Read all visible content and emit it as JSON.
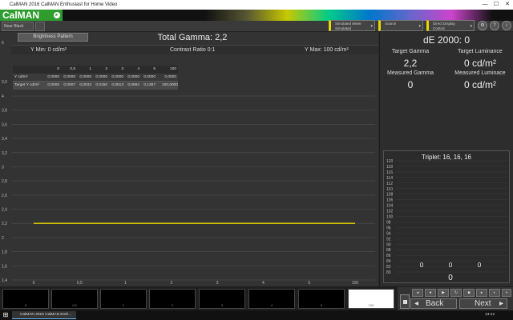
{
  "window": {
    "title": "CalMAN 2016 CalMAN Enthusiast for Home Video",
    "minimize": "—",
    "maximize": "☐",
    "close": "✕"
  },
  "app": {
    "logo": "CalMAN",
    "logo_icon": "play-arrow-icon"
  },
  "toolbar": {
    "near_black": "Near Black",
    "meter_select": {
      "line1": "Simulated Meter",
      "line2": "Simulated"
    },
    "source_select": {
      "line1": "Source"
    },
    "display_select": {
      "line1": "Direct Display Control"
    },
    "icons": [
      "settings-icon",
      "help-icon",
      "info-icon"
    ]
  },
  "main": {
    "pattern_button": "Brightness Pattern",
    "total_gamma_label": "Total Gamma: 2,2",
    "y_min": "Y Min: 0 cd/m²",
    "contrast": "Contrast Ratio 0:1",
    "y_max": "Y Max: 100 cd/m²",
    "table": {
      "headers": [
        "0",
        "0,5",
        "1",
        "2",
        "3",
        "4",
        "5",
        "100"
      ],
      "rows": [
        {
          "label": "Y cd/m²",
          "values": [
            "0,0000",
            "0,0000",
            "0,0000",
            "0,0000",
            "0,0000",
            "0,0000",
            "0,0000",
            "0,0000"
          ]
        },
        {
          "label": "Target Y cd/m²",
          "values": [
            "0,0000",
            "0,0007",
            "0,0033",
            "0,0150",
            "0,0513",
            "0,0892",
            "0,1387",
            "100,0000"
          ]
        }
      ]
    }
  },
  "chart_data": {
    "type": "line",
    "categories": [
      "0",
      "0,5",
      "1",
      "2",
      "3",
      "4",
      "5",
      "100"
    ],
    "y_ticks": [
      "1,4",
      "1,6",
      "1,8",
      "2",
      "2,2",
      "2,4",
      "2,6",
      "2,8",
      "3",
      "3,2",
      "3,4",
      "3,6",
      "3,8",
      "4"
    ],
    "top_ticks": [
      "3,0",
      "6"
    ],
    "ylim": [
      1.4,
      4.0
    ],
    "series": [
      {
        "values": [
          2.2,
          2.2,
          2.2,
          2.2,
          2.2,
          2.2,
          2.2,
          2.2
        ],
        "color": "#e6d800"
      }
    ],
    "grid": true
  },
  "right": {
    "de2000": "dE 2000: 0",
    "target_gamma_label": "Target  Gamma",
    "target_gamma_value": "2,2",
    "target_luminance_label": "Target Luminance",
    "target_luminance_value": "0 cd/m²",
    "measured_gamma_label": "Measured Gamma",
    "measured_gamma_value": "0",
    "measured_luminance_label": "Measured Luminace",
    "measured_luminance_value": "0 cd/m²",
    "triplet_label": "Triplet: 16, 16, 16",
    "triplet_values": [
      "0",
      "0",
      "0"
    ],
    "triplet_total": "0",
    "triplet_axis": [
      "120",
      "118",
      "116",
      "114",
      "112",
      "110",
      "108",
      "106",
      "104",
      "102",
      "100",
      "98",
      "96",
      "94",
      "92",
      "90",
      "88",
      "86",
      "84",
      "82",
      "80"
    ]
  },
  "bottom": {
    "swatches": [
      "0",
      "0,5",
      "1",
      "2",
      "3",
      "4",
      "5",
      "100"
    ],
    "back": "Back",
    "next": "Next"
  },
  "taskbar": {
    "app": "CalMAN 2016 CalMAN Enth...",
    "time": "13:12"
  }
}
